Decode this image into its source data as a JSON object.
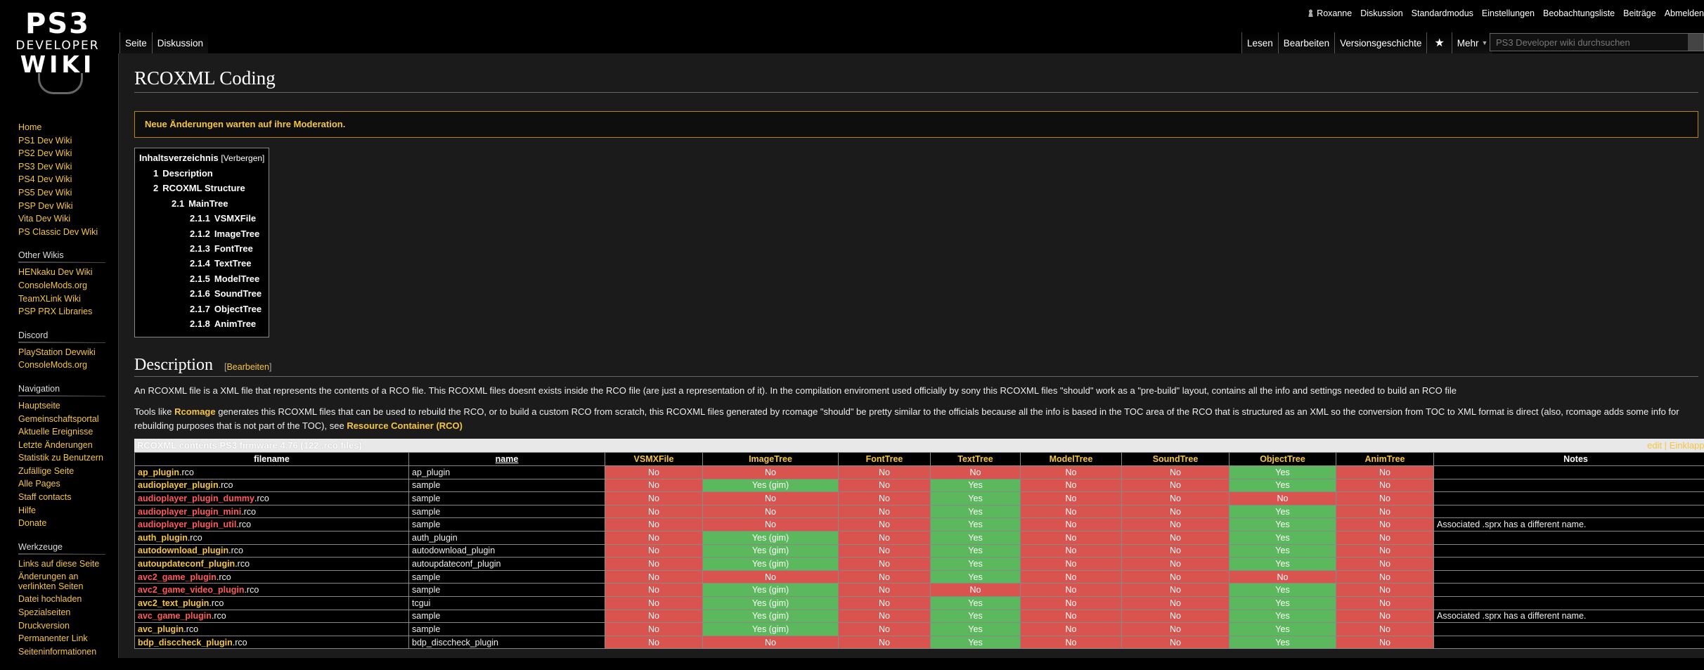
{
  "logo": {
    "line1": "PS3",
    "line2": "DEVELOPER",
    "line3": "WIKI"
  },
  "personal": {
    "user": "Roxanne",
    "links": [
      "Diskussion",
      "Standardmodus",
      "Einstellungen",
      "Beobachtungsliste",
      "Beiträge",
      "Abmelden"
    ]
  },
  "tabs_left": [
    "Seite",
    "Diskussion"
  ],
  "tabs_right": {
    "read": "Lesen",
    "edit": "Bearbeiten",
    "history": "Versionsgeschichte",
    "more": "Mehr"
  },
  "search": {
    "placeholder": "PS3 Developer wiki durchsuchen"
  },
  "sidebar": {
    "main": [
      "Home",
      "PS1 Dev Wiki",
      "PS2 Dev Wiki",
      "PS3 Dev Wiki",
      "PS4 Dev Wiki",
      "PS5 Dev Wiki",
      "PSP Dev Wiki",
      "Vita Dev Wiki",
      "PS Classic Dev Wiki"
    ],
    "other_title": "Other Wikis",
    "other": [
      "HENkaku Dev Wiki",
      "ConsoleMods.org",
      "TeamXLink Wiki",
      "PSP PRX Libraries"
    ],
    "discord_title": "Discord",
    "discord": [
      "PlayStation Devwiki",
      "ConsoleMods.org"
    ],
    "nav_title": "Navigation",
    "nav": [
      "Hauptseite",
      "Gemeinschaftsportal",
      "Aktuelle Ereignisse",
      "Letzte Änderungen",
      "Statistik zu Benutzern",
      "Zufällige Seite",
      "Alle Pages",
      "Staff contacts",
      "Hilfe",
      "Donate"
    ],
    "tools_title": "Werkzeuge",
    "tools": [
      "Links auf diese Seite",
      "Änderungen an verlinkten Seiten",
      "Datei hochladen",
      "Spezialseiten",
      "Druckversion",
      "Permanenter Link",
      "Seiteninformationen"
    ]
  },
  "page": {
    "title": "RCOXML Coding",
    "notice": "Neue Änderungen warten auf ihre Moderation."
  },
  "toc": {
    "title": "Inhaltsverzeichnis",
    "toggle": "[Verbergen]",
    "items": [
      {
        "num": "1",
        "label": "Description"
      },
      {
        "num": "2",
        "label": "RCOXML Structure"
      },
      {
        "num": "2.1",
        "label": "MainTree"
      },
      {
        "num": "2.1.1",
        "label": "VSMXFile"
      },
      {
        "num": "2.1.2",
        "label": "ImageTree"
      },
      {
        "num": "2.1.3",
        "label": "FontTree"
      },
      {
        "num": "2.1.4",
        "label": "TextTree"
      },
      {
        "num": "2.1.5",
        "label": "ModelTree"
      },
      {
        "num": "2.1.6",
        "label": "SoundTree"
      },
      {
        "num": "2.1.7",
        "label": "ObjectTree"
      },
      {
        "num": "2.1.8",
        "label": "AnimTree"
      }
    ]
  },
  "description": {
    "heading": "Description",
    "edit_open": "[",
    "edit_label": "Bearbeiten",
    "edit_close": "]",
    "p1": "An RCOXML file is a XML file that represents the contents of a RCO file. This RCOXML files doesnt exists inside the RCO file (are just a representation of it). In the compilation enviroment used officially by sony this RCOXML files \"should\" work as a \"pre-build\" layout, contains all the info and settings needed to build an RCO file",
    "p2_a": "Tools like ",
    "p2_link1": "Rcomage",
    "p2_b": " generates this RCOXML files that can be used to rebuild the RCO, or to build a custom RCO from scratch, this RCOXML files generated by rcomage \"should\" be pretty similar to the officials because all the info is based in the TOC area of the RCO that is structured as an XML so the conversion from TOC to XML format is direct (also, rcomage adds some info for rebuilding purposes that is not part of the TOC), see ",
    "p2_link2": "Resource Container (RCO)"
  },
  "table": {
    "caption": "RCOXML contents PS3 firmware 4.76 (122 .rco files)",
    "caption_links": "edit | Einklappen",
    "headers": [
      "filename",
      "name",
      "VSMXFile",
      "ImageTree",
      "FontTree",
      "TextTree",
      "ModelTree",
      "SoundTree",
      "ObjectTree",
      "AnimTree",
      "Notes"
    ],
    "rows": [
      {
        "file": "ap_plugin",
        "ext": ".rco",
        "red": false,
        "name": "ap_plugin",
        "c": [
          "No",
          "No",
          "No",
          "No",
          "No",
          "No",
          "Yes",
          "No"
        ],
        "notes": ""
      },
      {
        "file": "audioplayer_plugin",
        "ext": ".rco",
        "red": false,
        "name": "sample",
        "c": [
          "No",
          "Yes (gim)",
          "No",
          "Yes",
          "No",
          "No",
          "Yes",
          "No"
        ],
        "notes": ""
      },
      {
        "file": "audioplayer_plugin_dummy",
        "ext": ".rco",
        "red": true,
        "name": "sample",
        "c": [
          "No",
          "No",
          "No",
          "Yes",
          "No",
          "No",
          "No",
          "No"
        ],
        "notes": ""
      },
      {
        "file": "audioplayer_plugin_mini",
        "ext": ".rco",
        "red": true,
        "name": "sample",
        "c": [
          "No",
          "No",
          "No",
          "Yes",
          "No",
          "No",
          "Yes",
          "No"
        ],
        "notes": ""
      },
      {
        "file": "audioplayer_plugin_util",
        "ext": ".rco",
        "red": true,
        "name": "sample",
        "c": [
          "No",
          "No",
          "No",
          "Yes",
          "No",
          "No",
          "Yes",
          "No"
        ],
        "notes": "Associated .sprx has a different name."
      },
      {
        "file": "auth_plugin",
        "ext": ".rco",
        "red": false,
        "name": "auth_plugin",
        "c": [
          "No",
          "Yes (gim)",
          "No",
          "Yes",
          "No",
          "No",
          "Yes",
          "No"
        ],
        "notes": ""
      },
      {
        "file": "autodownload_plugin",
        "ext": ".rco",
        "red": false,
        "name": "autodownload_plugin",
        "c": [
          "No",
          "Yes (gim)",
          "No",
          "Yes",
          "No",
          "No",
          "Yes",
          "No"
        ],
        "notes": ""
      },
      {
        "file": "autoupdateconf_plugin",
        "ext": ".rco",
        "red": false,
        "name": "autoupdateconf_plugin",
        "c": [
          "No",
          "Yes (gim)",
          "No",
          "Yes",
          "No",
          "No",
          "Yes",
          "No"
        ],
        "notes": ""
      },
      {
        "file": "avc2_game_plugin",
        "ext": ".rco",
        "red": true,
        "name": "sample",
        "c": [
          "No",
          "No",
          "No",
          "Yes",
          "No",
          "No",
          "No",
          "No"
        ],
        "notes": ""
      },
      {
        "file": "avc2_game_video_plugin",
        "ext": ".rco",
        "red": true,
        "name": "sample",
        "c": [
          "No",
          "Yes (gim)",
          "No",
          "No",
          "No",
          "No",
          "Yes",
          "No"
        ],
        "notes": ""
      },
      {
        "file": "avc2_text_plugin",
        "ext": ".rco",
        "red": false,
        "name": "tcgui",
        "c": [
          "No",
          "Yes (gim)",
          "No",
          "Yes",
          "No",
          "No",
          "Yes",
          "No"
        ],
        "notes": ""
      },
      {
        "file": "avc_game_plugin",
        "ext": ".rco",
        "red": true,
        "name": "sample",
        "c": [
          "No",
          "Yes (gim)",
          "No",
          "Yes",
          "No",
          "No",
          "Yes",
          "No"
        ],
        "notes": "Associated .sprx has a different name."
      },
      {
        "file": "avc_plugin",
        "ext": ".rco",
        "red": false,
        "name": "sample",
        "c": [
          "No",
          "Yes (gim)",
          "No",
          "Yes",
          "No",
          "No",
          "Yes",
          "No"
        ],
        "notes": ""
      },
      {
        "file": "bdp_disccheck_plugin",
        "ext": ".rco",
        "red": false,
        "name": "bdp_disccheck_plugin",
        "c": [
          "No",
          "No",
          "No",
          "Yes",
          "No",
          "No",
          "Yes",
          "No"
        ],
        "notes": ""
      }
    ]
  }
}
